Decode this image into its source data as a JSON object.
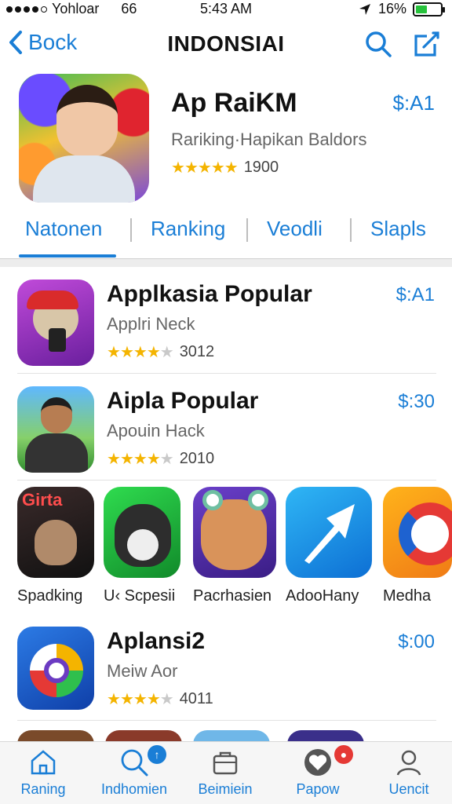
{
  "status_bar": {
    "carrier": "Yohloar",
    "network": "66",
    "time": "5:43 AM",
    "battery": "16%",
    "colors": {
      "battery_fill": "#27c23c"
    }
  },
  "nav": {
    "back_label": "Bock",
    "title": "INDONSIAI",
    "icons": [
      "search-icon",
      "compose-icon"
    ],
    "accent_color": "#1a7ed6"
  },
  "featured": {
    "name": "Ap RaiKM",
    "subtitle": "Rariking·Hapikan Baldors",
    "stars": 4.5,
    "rating_count": "1900",
    "price": "$:A1"
  },
  "tabs": [
    {
      "label": "Natonen",
      "selected": true
    },
    {
      "label": "Ranking",
      "selected": false
    },
    {
      "label": "Veodli",
      "selected": false
    },
    {
      "label": "Slapls",
      "selected": false
    }
  ],
  "list": [
    {
      "name": "Applkasia Popular",
      "subtitle": "Applri Neck",
      "stars": 4,
      "rating_count": "3012",
      "price": "$:A1"
    },
    {
      "name": "Aipla Popular",
      "subtitle": "Apouin Hack",
      "stars": 4,
      "rating_count": "2010",
      "price": "$:30"
    },
    {
      "name": "Aplansi2",
      "subtitle": "Meiw Aor",
      "stars": 4,
      "rating_count": "4011",
      "price": "$:00"
    }
  ],
  "grid": [
    {
      "label": "Spadking",
      "icon_text": "Girta"
    },
    {
      "label": "U‹ Scpesii"
    },
    {
      "label": "Pacrhasien"
    },
    {
      "label": "AdooHany"
    },
    {
      "label": "Medha"
    }
  ],
  "tab_bar": [
    {
      "label": "Raning",
      "icon": "home-icon"
    },
    {
      "label": "Indhomien",
      "icon": "search-icon",
      "badge_icon": "arrow-up-icon"
    },
    {
      "label": "Beimiein",
      "icon": "bag-icon"
    },
    {
      "label": "Papow",
      "icon": "heart-icon",
      "badge_icon": "pin-icon"
    },
    {
      "label": "Uencit",
      "icon": "person-icon"
    }
  ]
}
